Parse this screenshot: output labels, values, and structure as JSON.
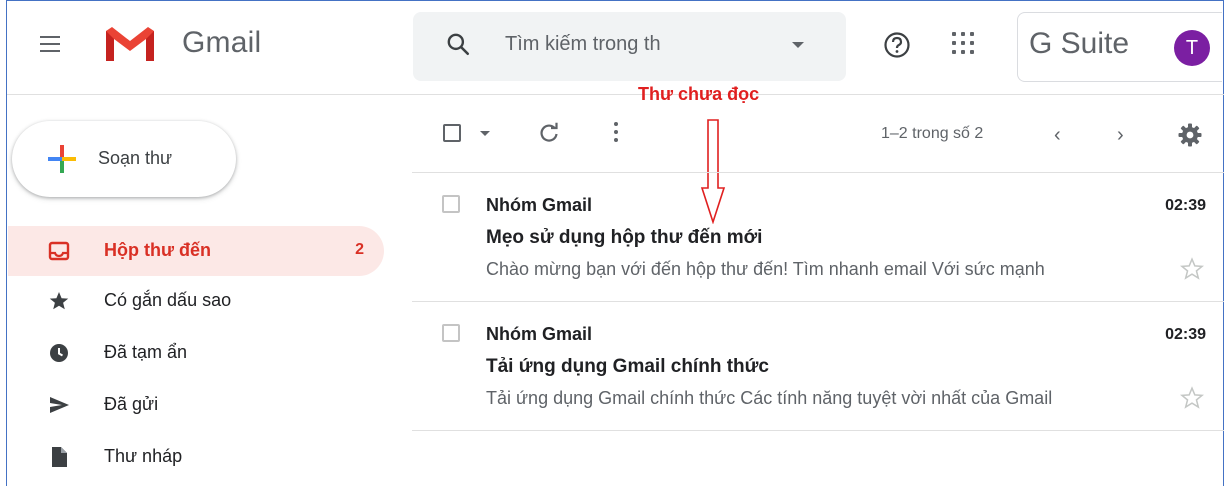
{
  "app": {
    "name": "Gmail",
    "suite_label": "G Suite",
    "avatar_initial": "T",
    "avatar_color": "#7b1fa2"
  },
  "search": {
    "placeholder": "Tìm kiếm trong th"
  },
  "compose": {
    "label": "Soạn thư"
  },
  "sidebar": {
    "items": [
      {
        "label": "Hộp thư đến",
        "count": "2",
        "icon": "inbox-icon",
        "active": true
      },
      {
        "label": "Có gắn dấu sao",
        "icon": "star-icon"
      },
      {
        "label": "Đã tạm ẩn",
        "icon": "clock-icon"
      },
      {
        "label": "Đã gửi",
        "icon": "send-icon"
      },
      {
        "label": "Thư nháp",
        "icon": "draft-icon"
      }
    ]
  },
  "toolbar": {
    "pagination": "1–2 trong số 2",
    "prev": "‹",
    "next": "›"
  },
  "annotation": {
    "label": "Thư chưa đọc",
    "color": "#e02020"
  },
  "emails": [
    {
      "sender": "Nhóm Gmail",
      "time": "02:39",
      "subject": "Mẹo sử dụng hộp thư đến mới",
      "snippet": "Chào mừng bạn với đến hộp thư đến! Tìm nhanh email Với sức mạnh"
    },
    {
      "sender": "Nhóm Gmail",
      "time": "02:39",
      "subject": "Tải ứng dụng Gmail chính thức",
      "snippet": "Tải ứng dụng Gmail chính thức Các tính năng tuyệt vời nhất của Gmail"
    }
  ],
  "colors": {
    "accent_red": "#d93025",
    "active_bg": "#fce8e6",
    "text_secondary": "#5f6368"
  }
}
